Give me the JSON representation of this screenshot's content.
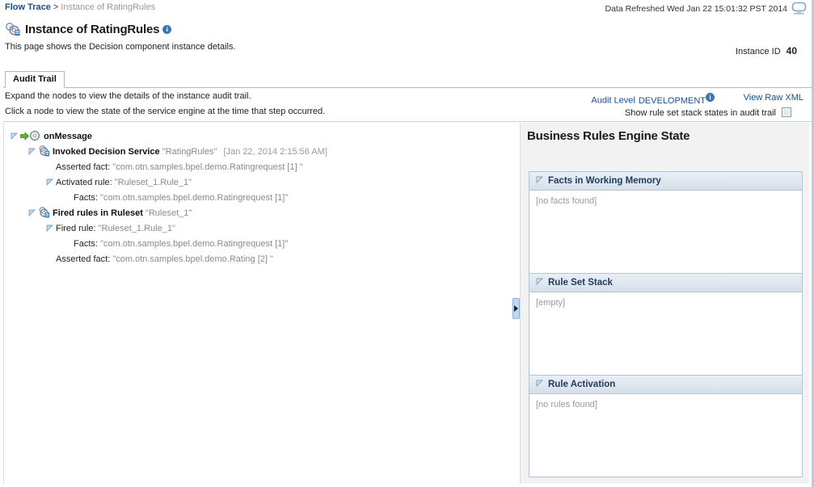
{
  "breadcrumb": {
    "root": "Flow Trace",
    "separator": ">",
    "current": "Instance of RatingRules"
  },
  "header": {
    "refreshed": "Data Refreshed Wed Jan 22 15:01:32 PST 2014",
    "monitor_icon": "monitor-icon",
    "title_icon": "decision-component-icon",
    "title": "Instance of RatingRules",
    "title_info_icon": "info-icon",
    "subtitle": "This page shows the Decision component instance details.",
    "instance_id_label": "Instance ID",
    "instance_id_value": "40"
  },
  "tabs": [
    {
      "label": "Audit Trail",
      "selected": true
    }
  ],
  "instructions": {
    "line1": "Expand the nodes to view the details of the instance audit trail.",
    "line2": "Click a node to view the state of the service engine at the time that step occurred."
  },
  "audit_controls": {
    "audit_level_label": "Audit Level",
    "audit_level_value": "DEVELOPMENT",
    "audit_level_info_icon": "info-icon",
    "view_raw_xml": "View Raw XML",
    "show_rule_set_label": "Show rule set stack states in audit trail",
    "show_rule_set_checked": false
  },
  "tree": [
    {
      "indent": 0,
      "twisty": "expanded",
      "icons": [
        "green-arrow-icon",
        "gear-icon"
      ],
      "label": "onMessage",
      "bold": true,
      "value": "",
      "time": ""
    },
    {
      "indent": 1,
      "twisty": "expanded",
      "icons": [
        "decision-service-icon"
      ],
      "label": "Invoked Decision Service",
      "bold": true,
      "value": "\"RatingRules\"",
      "time": "[Jan 22, 2014 2:15:56 AM]"
    },
    {
      "indent": 2,
      "twisty": "none",
      "icons": [],
      "label": "Asserted fact:",
      "bold": false,
      "value": "\"com.otn.samples.bpel.demo.Ratingrequest [1] \"",
      "time": ""
    },
    {
      "indent": 2,
      "twisty": "expanded",
      "icons": [],
      "label": "Activated rule:",
      "bold": false,
      "value": "\"Ruleset_1.Rule_1\"",
      "time": ""
    },
    {
      "indent": 3,
      "twisty": "none",
      "icons": [],
      "label": "Facts:",
      "bold": false,
      "value": "\"com.otn.samples.bpel.demo.Ratingrequest [1]\"",
      "time": ""
    },
    {
      "indent": 1,
      "twisty": "expanded",
      "icons": [
        "decision-service-icon"
      ],
      "label": "Fired rules in Ruleset",
      "bold": true,
      "value": "\"Ruleset_1\"",
      "time": ""
    },
    {
      "indent": 2,
      "twisty": "expanded",
      "icons": [],
      "label": "Fired rule:",
      "bold": false,
      "value": "\"Ruleset_1.Rule_1\"",
      "time": ""
    },
    {
      "indent": 3,
      "twisty": "none",
      "icons": [],
      "label": "Facts:",
      "bold": false,
      "value": "\"com.otn.samples.bpel.demo.Ratingrequest [1]\"",
      "time": ""
    },
    {
      "indent": 2,
      "twisty": "none",
      "icons": [],
      "label": "Asserted fact:",
      "bold": false,
      "value": "\"com.otn.samples.bpel.demo.Rating [2] \"",
      "time": ""
    }
  ],
  "splitter": {
    "icon": "collapse-right-icon"
  },
  "engine_state": {
    "title": "Business Rules Engine State",
    "sections": [
      {
        "header": "Facts in Working Memory",
        "body": "[no facts found]",
        "twisty": "expanded"
      },
      {
        "header": "Rule Set Stack",
        "body": "[empty]",
        "twisty": "expanded"
      },
      {
        "header": "Rule Activation",
        "body": "[no rules found]",
        "twisty": "expanded"
      }
    ]
  },
  "colors": {
    "link": "#1a4d8f",
    "muted": "#9a9a9a",
    "panel_bg": "#f2f2f2",
    "box_header_top": "#e9eff5",
    "box_header_bottom": "#d6e0eb",
    "border": "#b6c4d2"
  }
}
